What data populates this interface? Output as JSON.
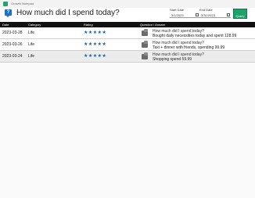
{
  "window": {
    "title": "Growth Notepad",
    "icon": "notepad-app-icon"
  },
  "header": {
    "icon": "question-bubble-icon",
    "title": "How much did I spend today?",
    "start_date_label": "Start Date",
    "start_date_value": "3/1/2023",
    "end_date_label": "End Date",
    "end_date_value": "3/31/2023",
    "query_button_label": "Query",
    "accent": "#1aa36a"
  },
  "table": {
    "columns": [
      "Date",
      "Category",
      "Rating",
      "Question / Answer"
    ],
    "rows": [
      {
        "date": "2023-03-28",
        "category": "Life",
        "rating": 5,
        "rating_text": "★★★★★",
        "question": "How much did I spend today?",
        "answer": "Bought daily necessities today and spent 128.99"
      },
      {
        "date": "2023-03-26",
        "category": "Life",
        "rating": 5,
        "rating_text": "★★★★★",
        "question": "How much did I spend today?",
        "answer": "Taxi + dinner with friends, spending 99.99"
      },
      {
        "date": "2023-03-24",
        "category": "Life",
        "rating": 5,
        "rating_text": "★★★★★",
        "question": "How much did I spend today?",
        "answer": "Shopping spend 59.99"
      }
    ]
  },
  "colors": {
    "header_bg": "#111111",
    "star": "#1e5fa8",
    "selected_row": "#ececec"
  }
}
